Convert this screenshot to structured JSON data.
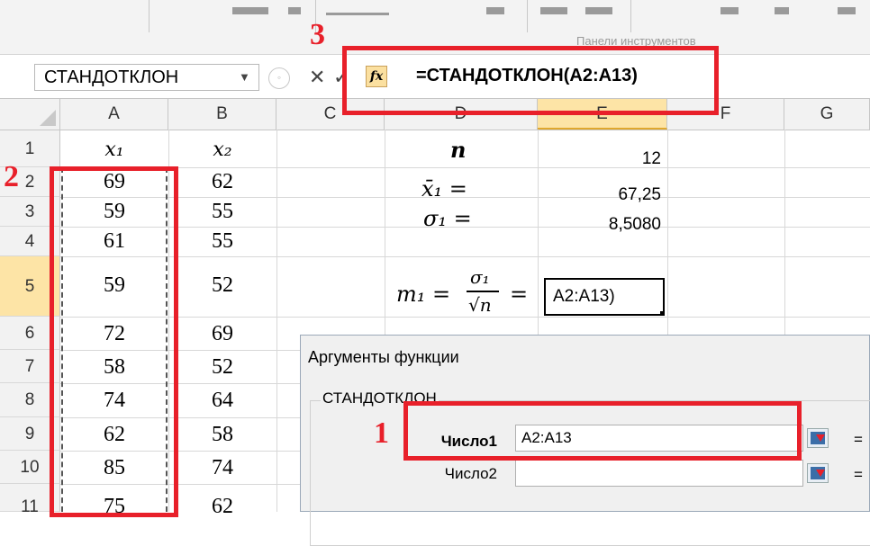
{
  "ribbon": {
    "group_label": "Панели инструментов"
  },
  "formula_bar": {
    "name_box": "СТАНДОТКЛОН",
    "cancel_icon": "✕",
    "enter_icon": "✓",
    "fx_label": "fx",
    "formula": "=СТАНДОТКЛОН(A2:A13)"
  },
  "columns": [
    "A",
    "B",
    "C",
    "D",
    "E",
    "F",
    "G"
  ],
  "selected_column": "E",
  "rows": [
    "1",
    "2",
    "3",
    "4",
    "5",
    "6",
    "7",
    "8",
    "9",
    "10",
    "11"
  ],
  "selected_row": "5",
  "headers": {
    "x1": "x₁",
    "x2": "x₂"
  },
  "colA": [
    "69",
    "59",
    "61",
    "59",
    "72",
    "58",
    "74",
    "62",
    "85",
    "75"
  ],
  "colB": [
    "62",
    "55",
    "55",
    "52",
    "69",
    "52",
    "64",
    "58",
    "74",
    "62"
  ],
  "colD": {
    "n": "n",
    "mean": "x̄₁ =",
    "sigma": "σ₁ =",
    "m_lhs": "m₁ =",
    "m_num": "σ₁",
    "m_den": "√n",
    "m_eq": "="
  },
  "colE": {
    "n_value": "12",
    "mean_value": "67,25",
    "sigma_value": "8,5080",
    "edit_value": "A2:A13)"
  },
  "annotations": {
    "one": "1",
    "two": "2",
    "three": "3"
  },
  "dialog": {
    "title": "Аргументы функции",
    "function_name": "СТАНДОТКЛОН",
    "arg1_label": "Число1",
    "arg1_value": "A2:A13",
    "arg2_label": "Число2",
    "arg2_value": "",
    "eq": "="
  },
  "colors": {
    "accent_red": "#e8202a",
    "selected_header": "#fde4a6"
  }
}
